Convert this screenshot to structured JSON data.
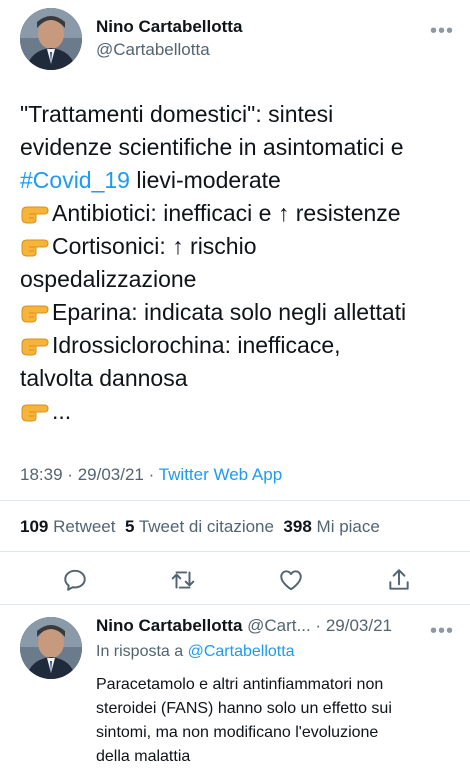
{
  "tweet": {
    "author_name": "Nino Cartabellotta",
    "author_handle": "@Cartabellotta",
    "more_icon": "•••",
    "lines": {
      "l1": "\"Trattamenti domestici\": sintesi",
      "l2": "evidenze scientifiche in asintomatici e",
      "l3_hashtag": "#Covid_19",
      "l3_rest": " lievi-moderate",
      "l4": "Antibiotici: inefficaci e ↑ resistenze",
      "l5": "Cortisonici: ↑ rischio",
      "l6": "ospedalizzazione",
      "l7": "Eparina: indicata solo negli allettati",
      "l8": "Idrossiclorochina: inefficace,",
      "l9": "talvolta dannosa",
      "l10": "..."
    },
    "emoji_icon": "backhand-index-pointing-right",
    "time": "18:39",
    "date": "29/03/21",
    "separator": "·",
    "source_app": "Twitter Web App"
  },
  "stats": {
    "retweets_count": "109",
    "retweets_label": "Retweet",
    "quotes_count": "5",
    "quotes_label": "Tweet di citazione",
    "likes_count": "398",
    "likes_label": "Mi piace"
  },
  "actions": [
    "reply-icon",
    "retweet-icon",
    "like-icon",
    "share-icon"
  ],
  "reply": {
    "author_name": "Nino Cartabellotta",
    "author_handle": "@Cart...",
    "separator": "·",
    "date": "29/03/21",
    "in_reply_prefix": "In risposta a",
    "in_reply_handle": "@Cartabellotta",
    "text_lines": {
      "r1": "Paracetamolo e altri antinfiammatori non",
      "r2": "steroidei (FANS) hanno solo un effetto sui",
      "r3": "sintomi, ma non modificano l'evoluzione",
      "r4": "della malattia"
    }
  },
  "colors": {
    "accent": "#1d9bf0",
    "text": "#0f1419",
    "secondary": "#536471",
    "divider": "#e1e6ea"
  }
}
